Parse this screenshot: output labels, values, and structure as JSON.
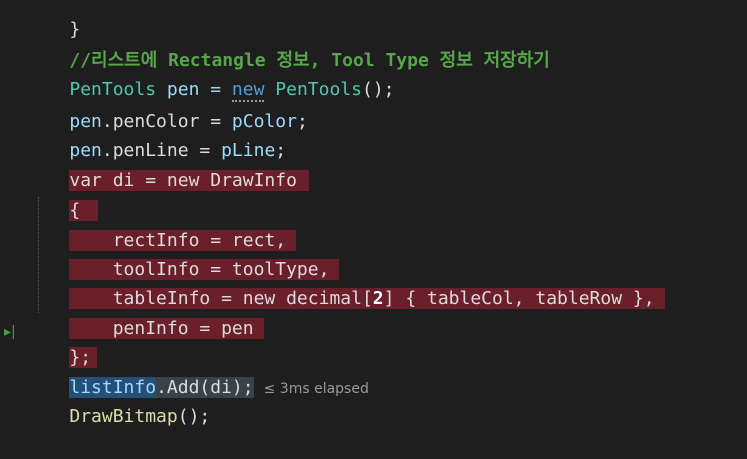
{
  "editor": {
    "lines": [
      {
        "text": "}"
      },
      {
        "text": "//리스트에 Rectangle 정보, Tool Type 정보 저장하기"
      },
      {
        "tokens": [
          "PenTools",
          " pen = ",
          "new",
          " ",
          "PenTools",
          "();"
        ]
      },
      {
        "tokens": [
          "pen",
          ".penColor = ",
          "pColor",
          ";"
        ]
      },
      {
        "tokens": [
          "pen",
          ".penLine = ",
          "pLine",
          ";"
        ]
      },
      {
        "text": "var di = new DrawInfo"
      },
      {
        "text": "{"
      },
      {
        "text": "    rectInfo = rect,"
      },
      {
        "text": "    toolInfo = toolType,"
      },
      {
        "tokens": [
          "    tableInfo = new decimal[",
          "2",
          "] { tableCol, tableRow },"
        ]
      },
      {
        "text": "    penInfo = pen"
      },
      {
        "text": "};"
      },
      {
        "tokens": [
          "listInfo",
          ".Add(di);"
        ],
        "hint": "≤ 3ms elapsed"
      },
      {
        "tokens": [
          "DrawBitmap",
          "();"
        ]
      }
    ],
    "gutter_marker": "▸|"
  }
}
